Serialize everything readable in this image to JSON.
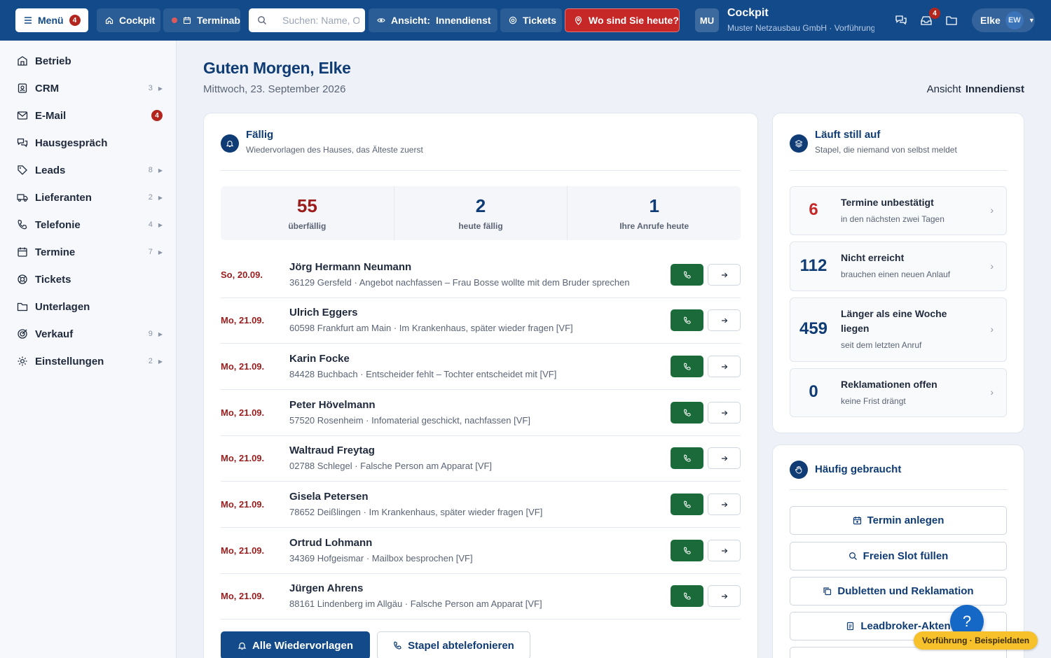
{
  "colors": {
    "topbar": "#124a8a",
    "accent": "#0f3c74",
    "danger": "#c62828",
    "call_button": "#1b6b3a",
    "badge": "#b3261e",
    "demo_pill": "#f6c12a"
  },
  "topbar": {
    "menu_label": "Menü",
    "menu_badge": "4",
    "cockpit_label": "Cockpit",
    "termin_label": "Terminabsage",
    "search_placeholder": "Suchen: Name, Ort …",
    "ansicht_prefix": "Ansicht:",
    "ansicht_value": "Innendienst",
    "tickets_label": "Tickets",
    "where_label": "Wo sind Sie heute?",
    "company_short": "MU",
    "app_title": "Cockpit",
    "company_subtitle": "Muster Netzausbau GmbH · Vorführung",
    "inbox_badge": "4",
    "user_name": "Elke",
    "user_initials": "EW",
    "icons": [
      "menu-icon",
      "home-icon",
      "calendar-icon",
      "search-icon",
      "eye-icon",
      "ticket-icon",
      "pin-icon",
      "chat-icon",
      "inbox-icon",
      "folder-icon"
    ]
  },
  "sidebar": {
    "items": [
      {
        "label": "Betrieb",
        "count": "",
        "badge": "",
        "icon": "building-icon"
      },
      {
        "label": "CRM",
        "count": "3",
        "badge": "",
        "icon": "contacts-icon"
      },
      {
        "label": "E-Mail",
        "count": "",
        "badge": "4",
        "icon": "mail-icon"
      },
      {
        "label": "Hausgespräch",
        "count": "",
        "badge": "",
        "icon": "chat-icon"
      },
      {
        "label": "Leads",
        "count": "8",
        "badge": "",
        "icon": "tag-icon"
      },
      {
        "label": "Lieferanten",
        "count": "2",
        "badge": "",
        "icon": "truck-icon"
      },
      {
        "label": "Telefonie",
        "count": "4",
        "badge": "",
        "icon": "phone-icon"
      },
      {
        "label": "Termine",
        "count": "7",
        "badge": "",
        "icon": "calendar-icon"
      },
      {
        "label": "Tickets",
        "count": "",
        "badge": "",
        "icon": "lifebuoy-icon"
      },
      {
        "label": "Unterlagen",
        "count": "",
        "badge": "",
        "icon": "folder-icon"
      },
      {
        "label": "Verkauf",
        "count": "9",
        "badge": "",
        "icon": "target-icon"
      },
      {
        "label": "Einstellungen",
        "count": "2",
        "badge": "",
        "icon": "gear-icon"
      }
    ]
  },
  "header": {
    "greeting": "Guten Morgen, Elke",
    "date": "Mittwoch, 23. September 2026",
    "view_label": "Ansicht",
    "view_value": "Innendienst"
  },
  "faellig": {
    "title": "Fällig",
    "subtitle": "Wiedervorlagen des Hauses, das Älteste zuerst",
    "stats": [
      {
        "value": "55",
        "label": "überfällig"
      },
      {
        "value": "2",
        "label": "heute fällig"
      },
      {
        "value": "1",
        "label": "Ihre Anrufe heute"
      }
    ],
    "rows": [
      {
        "date": "So, 20.09.",
        "name": "Jörg Hermann Neumann",
        "desc": "36129 Gersfeld · Angebot nachfassen – Frau Bosse wollte mit dem Bruder sprechen"
      },
      {
        "date": "Mo, 21.09.",
        "name": "Ulrich Eggers",
        "desc": "60598 Frankfurt am Main · Im Krankenhaus, später wieder fragen [VF]"
      },
      {
        "date": "Mo, 21.09.",
        "name": "Karin Focke",
        "desc": "84428 Buchbach · Entscheider fehlt – Tochter entscheidet mit [VF]"
      },
      {
        "date": "Mo, 21.09.",
        "name": "Peter Hövelmann",
        "desc": "57520 Rosenheim · Infomaterial geschickt, nachfassen [VF]"
      },
      {
        "date": "Mo, 21.09.",
        "name": "Waltraud Freytag",
        "desc": "02788 Schlegel · Falsche Person am Apparat [VF]"
      },
      {
        "date": "Mo, 21.09.",
        "name": "Gisela Petersen",
        "desc": "78652 Deißlingen · Im Krankenhaus, später wieder fragen [VF]"
      },
      {
        "date": "Mo, 21.09.",
        "name": "Ortrud Lohmann",
        "desc": "34369 Hofgeismar · Mailbox besprochen [VF]"
      },
      {
        "date": "Mo, 21.09.",
        "name": "Jürgen Ahrens",
        "desc": "88161 Lindenberg im Allgäu · Falsche Person am Apparat [VF]"
      }
    ],
    "btn_all": "Alle Wiedervorlagen",
    "btn_batch": "Stapel abtelefonieren"
  },
  "still": {
    "title": "Läuft still auf",
    "subtitle": "Stapel, die niemand von selbst meldet",
    "tiles": [
      {
        "value": "6",
        "title": "Termine unbestätigt",
        "sub": "in den nächsten zwei Tagen"
      },
      {
        "value": "112",
        "title": "Nicht erreicht",
        "sub": "brauchen einen neuen Anlauf"
      },
      {
        "value": "459",
        "title": "Länger als eine Woche liegen",
        "sub": "seit dem letzten Anruf"
      },
      {
        "value": "0",
        "title": "Reklamationen offen",
        "sub": "keine Frist drängt"
      }
    ]
  },
  "haeufig": {
    "title": "Häufig gebraucht",
    "buttons": [
      {
        "label": "Termin anlegen",
        "icon": "calendar-plus-icon"
      },
      {
        "label": "Freien Slot füllen",
        "icon": "search-icon"
      },
      {
        "label": "Dubletten und Reklamation",
        "icon": "copy-icon"
      },
      {
        "label": "Leadbroker-Akten",
        "icon": "file-icon"
      }
    ]
  },
  "help_label": "?",
  "demo_label": "Vorführung · Beispieldaten"
}
